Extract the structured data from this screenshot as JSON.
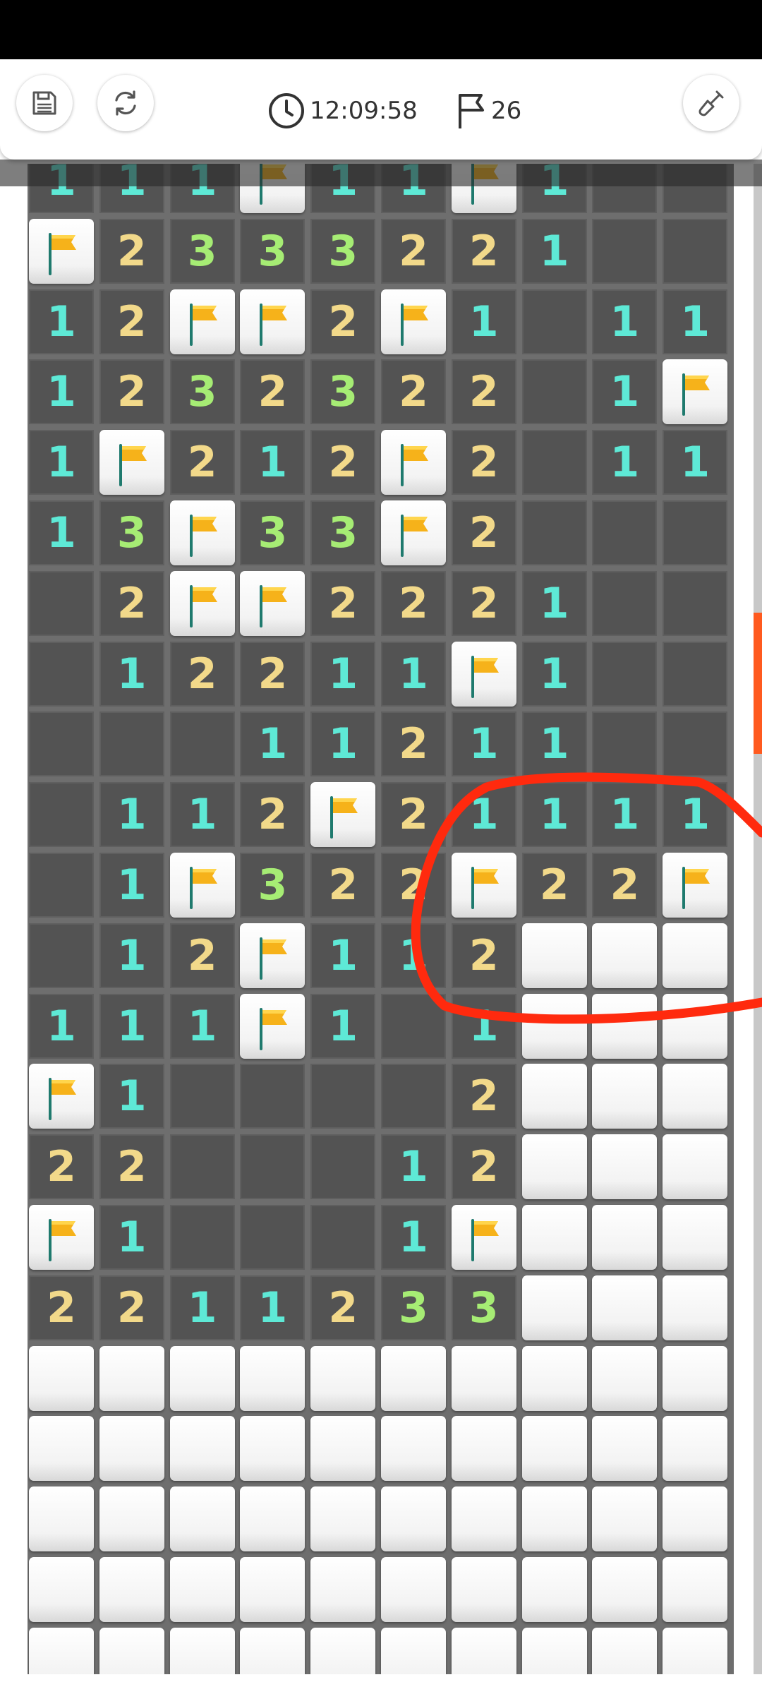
{
  "toolbar": {
    "timer": "12:09:58",
    "flags_remaining": "26",
    "icons": [
      "save-icon",
      "restart-icon",
      "clock-icon",
      "flag-icon",
      "shovel-icon"
    ]
  },
  "colors": {
    "number_1": "#5ee9d6",
    "number_2": "#f2d98a",
    "number_3": "#a6ec74",
    "flag": "#f6b21a",
    "open_cell": "#535353",
    "annotation": "#ff2a0e",
    "scroll_thumb": "#ff5a1f"
  },
  "board": {
    "columns": 10,
    "legend": "digit = revealed number, F = flagged, H = unopened, . = revealed empty",
    "rows": [
      [
        "1",
        "1",
        "1",
        "F",
        "1",
        "1",
        "F",
        "1",
        ".",
        "."
      ],
      [
        "F",
        "2",
        "3",
        "3",
        "3",
        "2",
        "2",
        "1",
        ".",
        "."
      ],
      [
        "1",
        "2",
        "F",
        "F",
        "2",
        "F",
        "1",
        ".",
        "1",
        "1"
      ],
      [
        "1",
        "2",
        "3",
        "2",
        "3",
        "2",
        "2",
        ".",
        "1",
        "F"
      ],
      [
        "1",
        "F",
        "2",
        "1",
        "2",
        "F",
        "2",
        ".",
        "1",
        "1"
      ],
      [
        "1",
        "3",
        "F",
        "3",
        "3",
        "F",
        "2",
        ".",
        ".",
        "."
      ],
      [
        ".",
        "2",
        "F",
        "F",
        "2",
        "2",
        "2",
        "1",
        ".",
        "."
      ],
      [
        ".",
        "1",
        "2",
        "2",
        "1",
        "1",
        "F",
        "1",
        ".",
        "."
      ],
      [
        ".",
        ".",
        ".",
        "1",
        "1",
        "2",
        "1",
        "1",
        ".",
        "."
      ],
      [
        ".",
        "1",
        "1",
        "2",
        "F",
        "2",
        "1",
        "1",
        "1",
        "1"
      ],
      [
        ".",
        "1",
        "F",
        "3",
        "2",
        "2",
        "F",
        "2",
        "2",
        "F"
      ],
      [
        ".",
        "1",
        "2",
        "F",
        "1",
        "1",
        "2",
        "H",
        "H",
        "H"
      ],
      [
        "1",
        "1",
        "1",
        "F",
        "1",
        ".",
        "1",
        "H",
        "H",
        "H"
      ],
      [
        "F",
        "1",
        ".",
        ".",
        ".",
        ".",
        "2",
        "H",
        "H",
        "H"
      ],
      [
        "2",
        "2",
        ".",
        ".",
        ".",
        "1",
        "2",
        "H",
        "H",
        "H"
      ],
      [
        "F",
        "1",
        ".",
        ".",
        ".",
        "1",
        "F",
        "H",
        "H",
        "H"
      ],
      [
        "2",
        "2",
        "1",
        "1",
        "2",
        "3",
        "3",
        "H",
        "H",
        "H"
      ],
      [
        "H",
        "H",
        "H",
        "H",
        "H",
        "H",
        "H",
        "H",
        "H",
        "H"
      ],
      [
        "H",
        "H",
        "H",
        "H",
        "H",
        "H",
        "H",
        "H",
        "H",
        "H"
      ],
      [
        "H",
        "H",
        "H",
        "H",
        "H",
        "H",
        "H",
        "H",
        "H",
        "H"
      ],
      [
        "H",
        "H",
        "H",
        "H",
        "H",
        "H",
        "H",
        "H",
        "H",
        "H"
      ],
      [
        "H",
        "H",
        "H",
        "H",
        "H",
        "H",
        "H",
        "H",
        "H",
        "H"
      ]
    ]
  }
}
